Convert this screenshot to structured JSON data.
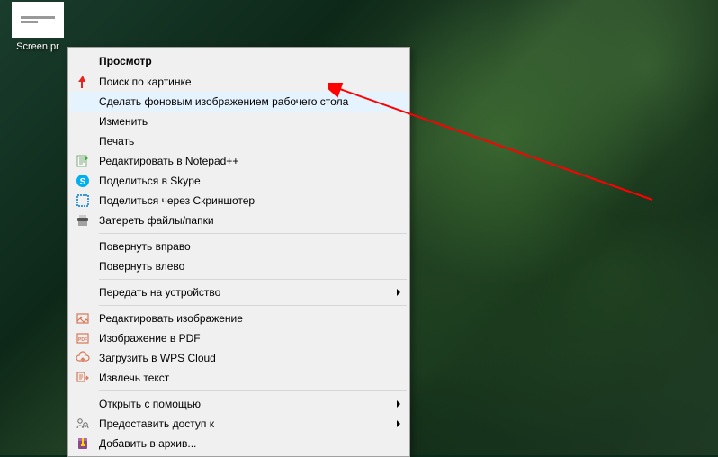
{
  "desktopIcon": {
    "label": "Screen\npr"
  },
  "contextMenu": {
    "header": "Просмотр",
    "items": {
      "searchByImage": "Поиск по картинке",
      "setAsWallpaper": "Сделать фоновым изображением рабочего стола",
      "edit": "Изменить",
      "print": "Печать",
      "editNotepad": "Редактировать в Notepad++",
      "shareSkype": "Поделиться в Skype",
      "shareScreenshoter": "Поделиться через Скриншотер",
      "wipeFiles": "Затереть файлы/папки",
      "rotateRight": "Повернуть вправо",
      "rotateLeft": "Повернуть влево",
      "castToDevice": "Передать на устройство",
      "editImage": "Редактировать изображение",
      "imageToPdf": "Изображение в PDF",
      "uploadWpsCloud": "Загрузить в WPS Cloud",
      "extractText": "Извлечь текст",
      "openWith": "Открыть с помощью",
      "grantAccess": "Предоставить доступ к",
      "addToArchive": "Добавить в архив..."
    }
  }
}
